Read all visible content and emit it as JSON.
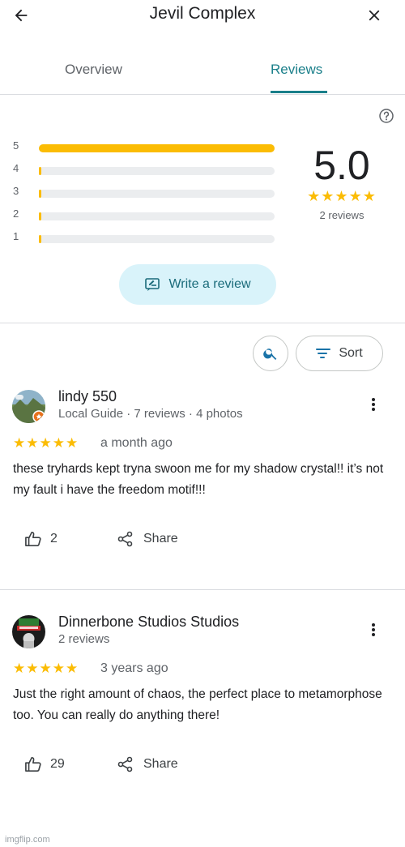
{
  "header": {
    "title": "Jevil Complex",
    "back_icon": "arrow-left-icon",
    "close_icon": "close-icon"
  },
  "tabs": [
    {
      "label": "Overview",
      "active": false
    },
    {
      "label": "Reviews",
      "active": true
    }
  ],
  "colors": {
    "accent": "#1a7f8a",
    "star": "#fbbc04",
    "write_button_bg": "#d9f3fa"
  },
  "summary": {
    "rating": "5.0",
    "stars": "★★★★★",
    "review_count": "2 reviews",
    "distribution": [
      {
        "stars": "5",
        "fraction": 1.0
      },
      {
        "stars": "4",
        "fraction": 0.0
      },
      {
        "stars": "3",
        "fraction": 0.0
      },
      {
        "stars": "2",
        "fraction": 0.0
      },
      {
        "stars": "1",
        "fraction": 0.0
      }
    ]
  },
  "write_review": {
    "label": "Write a review",
    "icon": "write-review-icon"
  },
  "toolbar": {
    "sort_label": "Sort",
    "search_icon": "search-icon",
    "sort_icon": "sort-lines-icon"
  },
  "reviews": [
    {
      "name": "lindy 550",
      "meta": "Local Guide · 7 reviews · 4 photos",
      "stars": "★★★★★",
      "time": "a month ago",
      "text": "these tryhards kept tryna swoon me for my shadow crystal!! it’s not my fault i have the freedom motif!!!",
      "likes": "2",
      "share_label": "Share"
    },
    {
      "name": "Dinnerbone Studios Studios",
      "meta": "2 reviews",
      "stars": "★★★★★",
      "time": "3 years ago",
      "text": "Just the right amount of chaos, the perfect place to metamorphose too. You can really do anything there!",
      "likes": "29",
      "share_label": "Share"
    }
  ],
  "watermark": "imgflip.com"
}
